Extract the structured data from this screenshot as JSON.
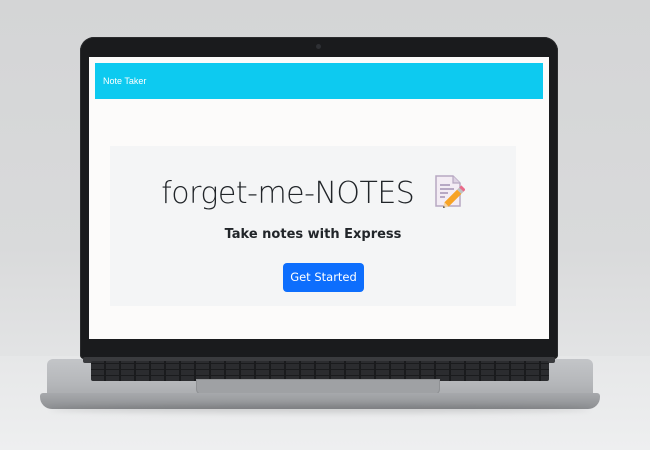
{
  "navbar": {
    "brand": "Note Taker"
  },
  "hero": {
    "title": "forget-me-NOTES",
    "title_icon": "memo-icon",
    "tagline": "Take notes with Express",
    "cta_label": "Get Started"
  },
  "colors": {
    "navbar": "#0dcaf0",
    "cta": "#0d6efd",
    "hero_background": "#f4f5f6",
    "page_background": "#fcfbfa"
  }
}
